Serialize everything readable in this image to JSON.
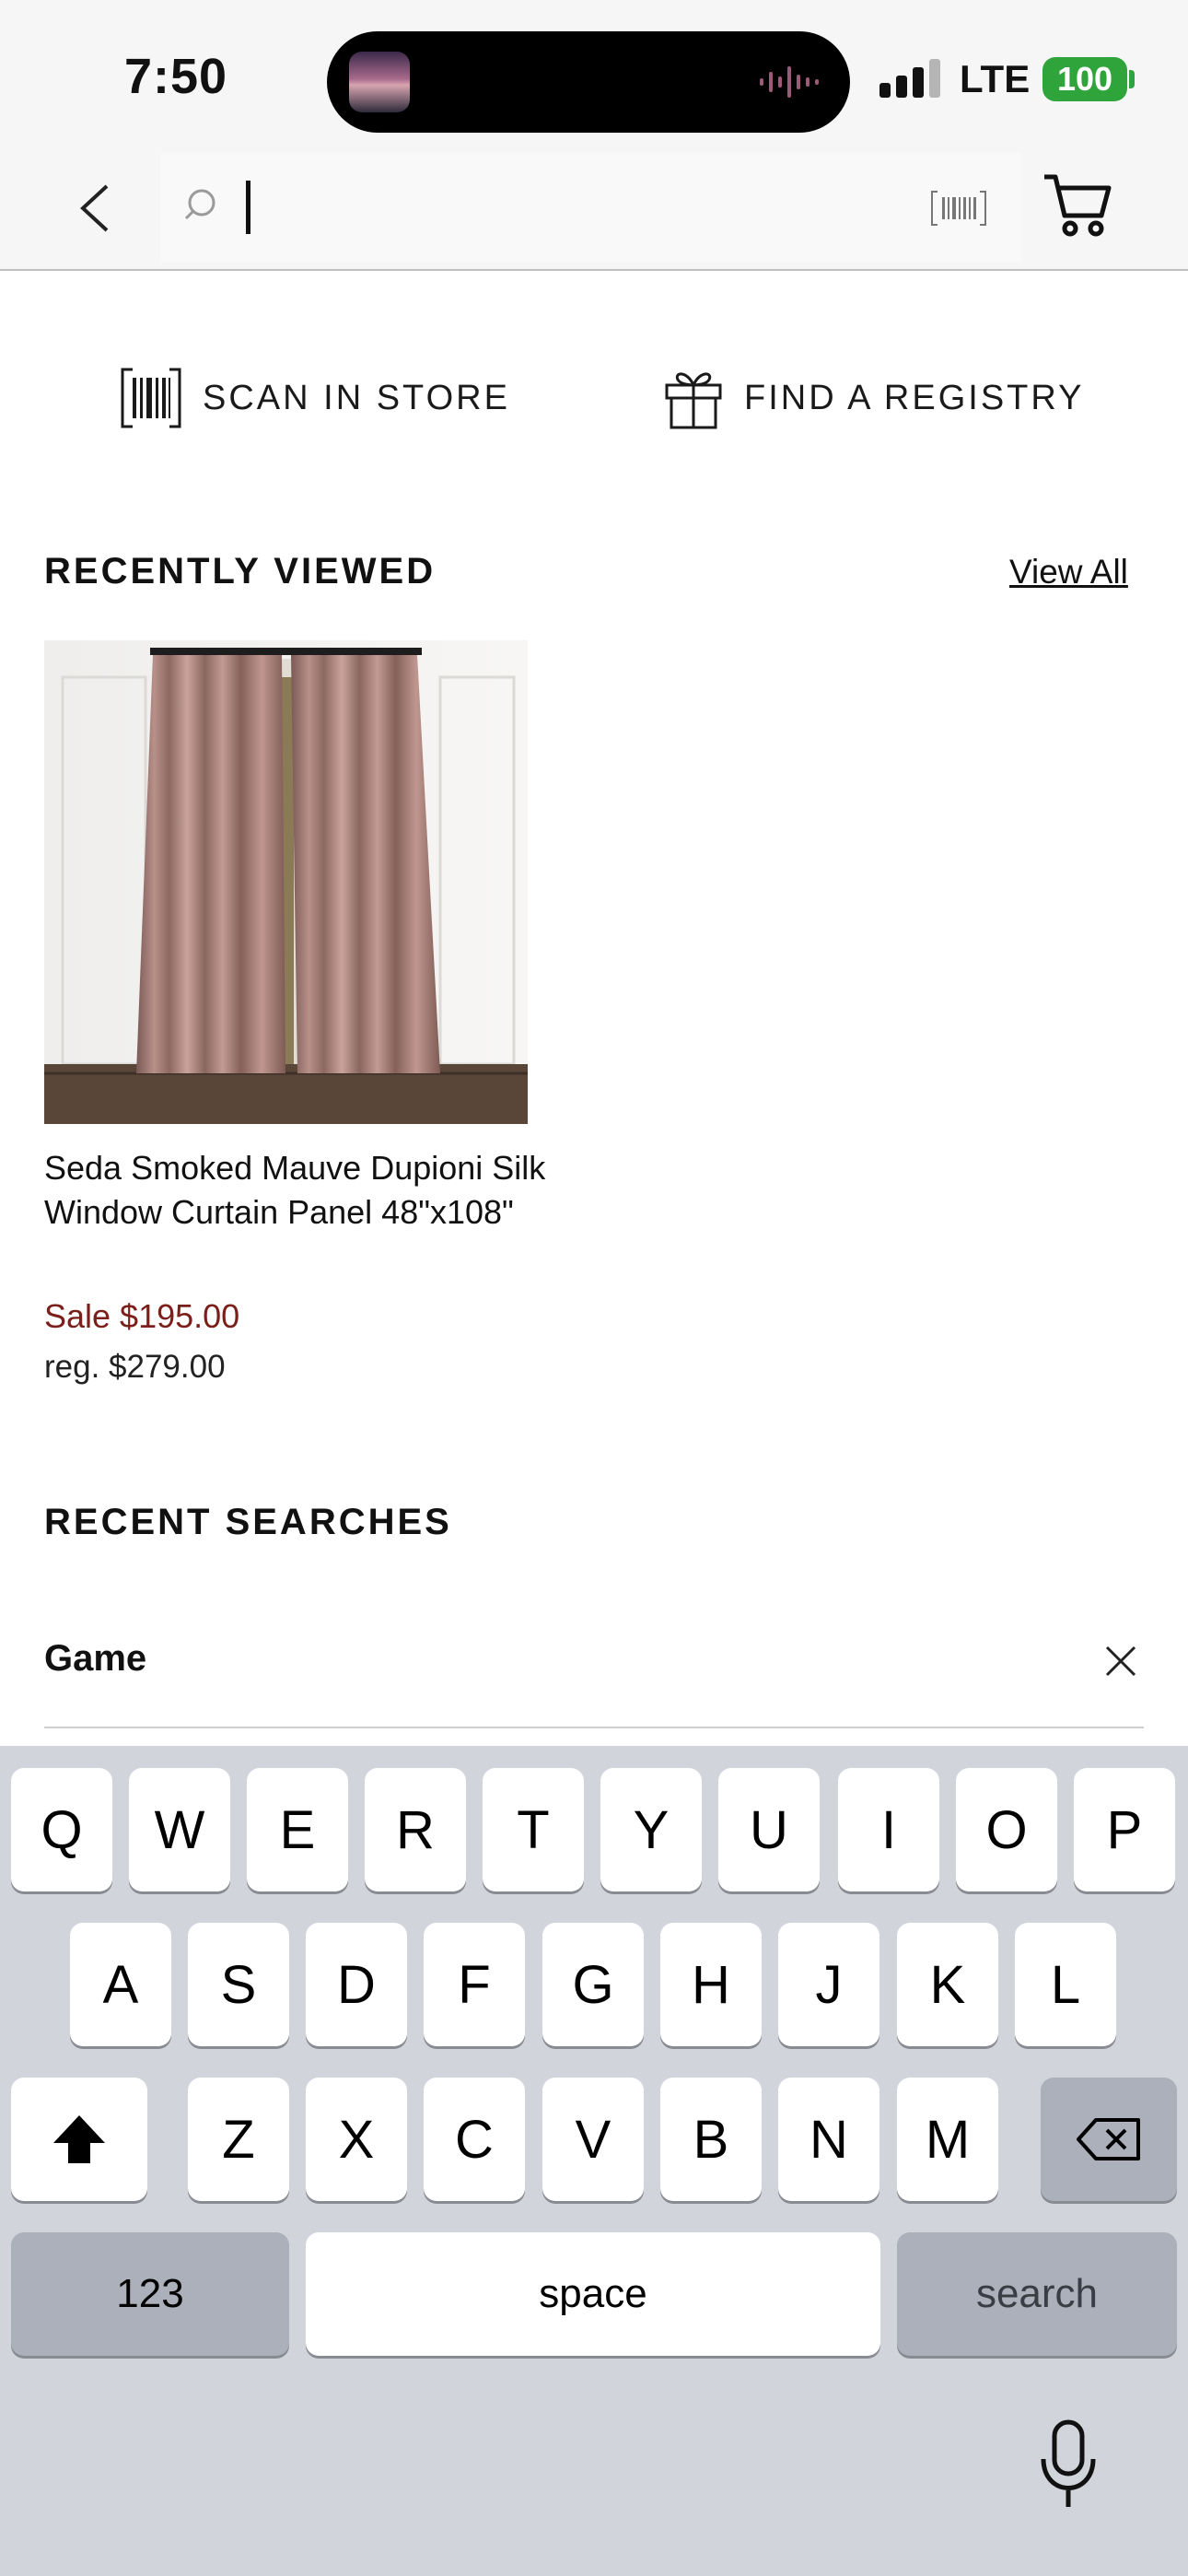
{
  "status_bar": {
    "time": "7:50",
    "network": "LTE",
    "battery": "100"
  },
  "search": {
    "placeholder": "",
    "value": ""
  },
  "quick_actions": {
    "scan_label": "SCAN IN STORE",
    "registry_label": "FIND A REGISTRY"
  },
  "recently_viewed": {
    "title": "RECENTLY VIEWED",
    "view_all": "View All",
    "product": {
      "name": "Seda Smoked Mauve Dupioni Silk Window Curtain Panel 48\"x108\"",
      "sale_price": "Sale $195.00",
      "reg_price": "reg. $279.00"
    }
  },
  "recent_searches": {
    "title": "RECENT SEARCHES",
    "items": [
      {
        "label": "Game"
      }
    ]
  },
  "keyboard": {
    "row1": [
      "Q",
      "W",
      "E",
      "R",
      "T",
      "Y",
      "U",
      "I",
      "O",
      "P"
    ],
    "row2": [
      "A",
      "S",
      "D",
      "F",
      "G",
      "H",
      "J",
      "K",
      "L"
    ],
    "row3": [
      "Z",
      "X",
      "C",
      "V",
      "B",
      "N",
      "M"
    ],
    "numbers_label": "123",
    "space_label": "space",
    "search_label": "search"
  },
  "colors": {
    "sale": "#7a1f1a",
    "battery": "#2fa43a",
    "keyboard_bg": "#d1d4db"
  },
  "icons": [
    "chevron-left-icon",
    "search-icon",
    "barcode-icon",
    "cart-icon",
    "gift-icon",
    "close-icon",
    "shift-icon",
    "backspace-icon",
    "microphone-icon"
  ]
}
